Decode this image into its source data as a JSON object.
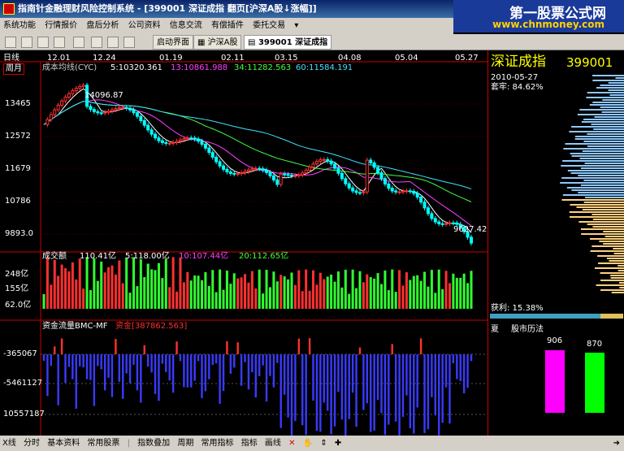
{
  "window": {
    "title": "指南针金融理财风险控制系统 - [399001 深证成指 翻页[沪深A股↓涨幅]]"
  },
  "watermark": {
    "line1": "第一股票公式网",
    "line2": "www.chnmoney.com"
  },
  "menu": [
    "系统功能",
    "行情报价",
    "盘后分析",
    "公司资料",
    "信息交流",
    "有偿插件",
    "委托交易"
  ],
  "toolbar": {
    "tabs": [
      "启动界面",
      "沪深A股",
      "399001 深证成指"
    ]
  },
  "price_panel": {
    "period_label": "日线",
    "cycle_label": "周月",
    "indicator": "成本均线(CYC)",
    "ma5": "5:10320.361",
    "ma13": "13:10861.988",
    "ma34": "34:11282.563",
    "ma60": "60:11584.191",
    "dates": [
      "12.01",
      "12.24",
      "01.19",
      "02.11",
      "03.15",
      "04.08",
      "05.04",
      "05.27"
    ],
    "y_ticks": [
      "13465",
      "12572",
      "11679",
      "10786",
      "9893.0"
    ],
    "high_mark": "14096.87",
    "low_mark": "9627.42"
  },
  "volume_panel": {
    "title": "成交额",
    "total": "110.41亿",
    "ma5": "5:118.00亿",
    "ma10": "10:107.44亿",
    "ma20": "20:112.65亿",
    "y_ticks": [
      "248亿",
      "155亿",
      "62.0亿"
    ]
  },
  "flow_panel": {
    "title": "资金流量BMC-MF",
    "value": "资金[387862.563]",
    "y_ticks": [
      "-365067",
      "-5461127",
      "10557187"
    ]
  },
  "right_panel": {
    "name": "深证成指",
    "code": "399001",
    "date": "2010-05-27",
    "trap_ratio": "套牢: 84.62%",
    "profit_ratio": "获利: 15.38%",
    "season": "夏",
    "calendar_title": "股市历法",
    "bars": [
      {
        "label": "906",
        "value": 906,
        "color": "#ff00ff"
      },
      {
        "label": "870",
        "value": 870,
        "color": "#00ff00"
      }
    ]
  },
  "statusbar": {
    "items": [
      "X线",
      "分时",
      "基本资料",
      "常用股票",
      "指数叠加",
      "周期",
      "常用指标",
      "指标",
      "画线"
    ]
  },
  "colors": {
    "up": "#ff3030",
    "down": "#00ffff",
    "ma5": "#ffffff",
    "ma13": "#ff40ff",
    "ma34": "#40ff40",
    "ma60": "#40e0ff"
  }
}
